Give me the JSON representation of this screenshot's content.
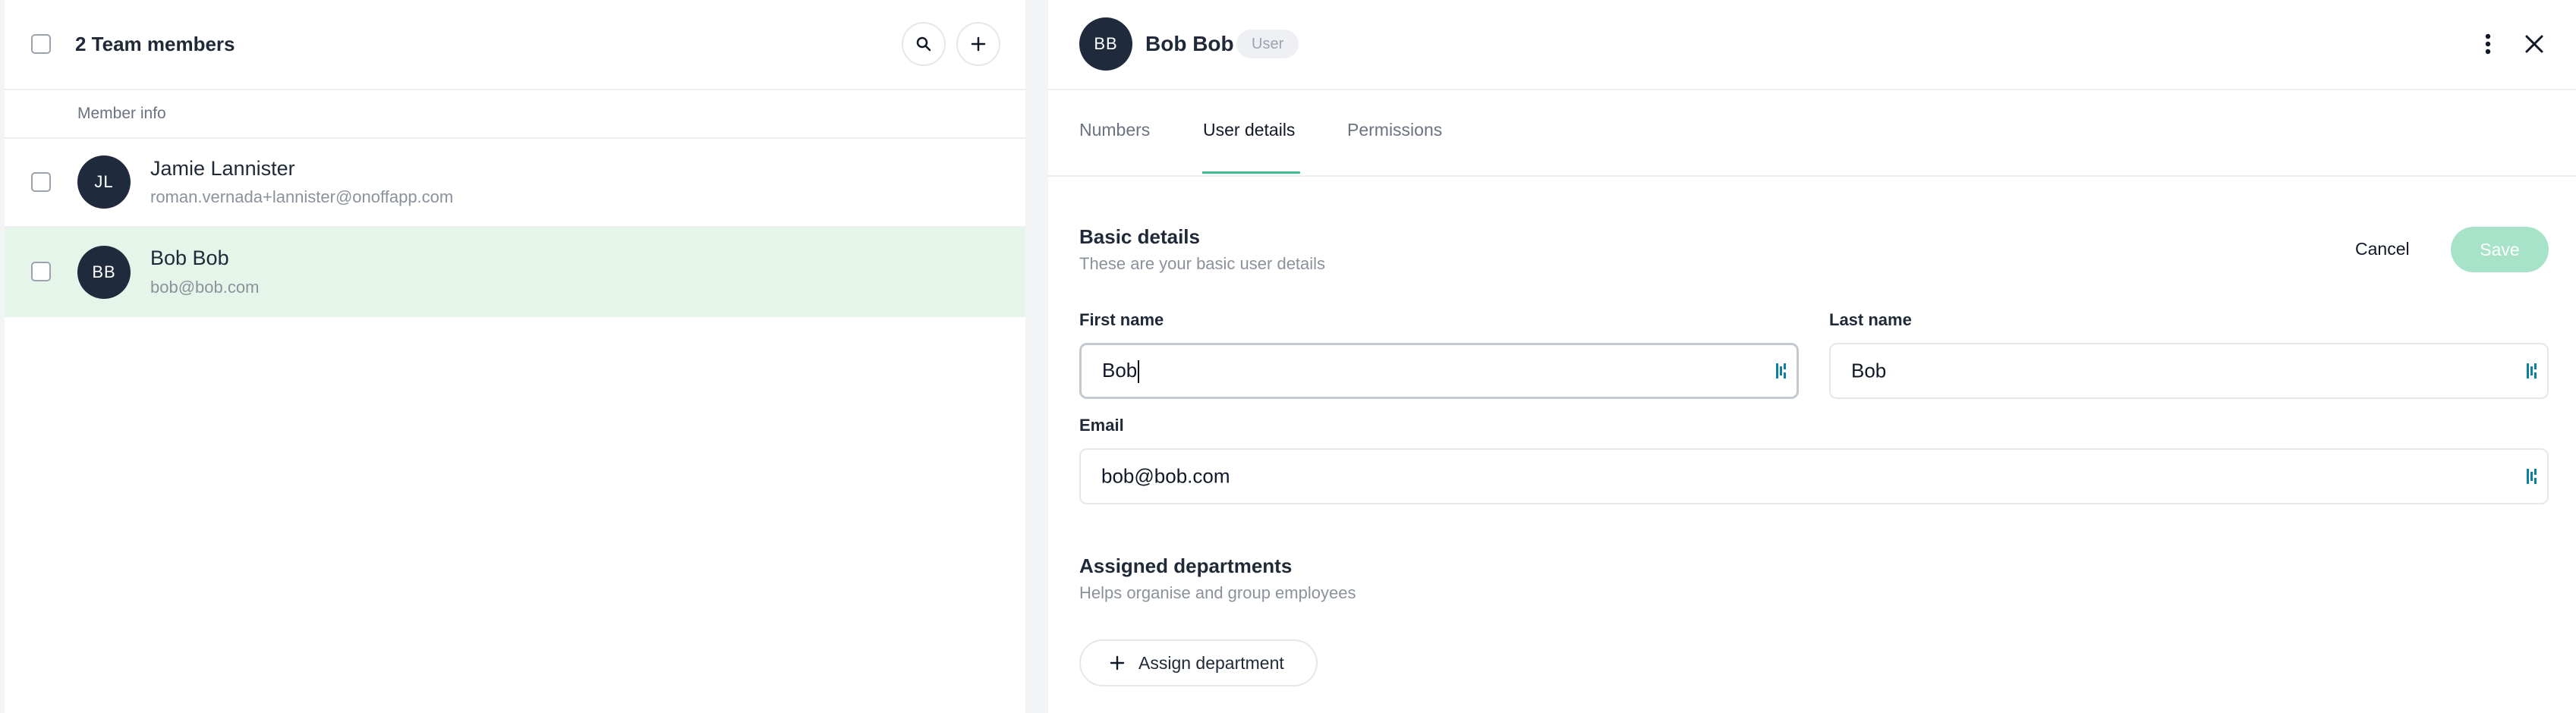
{
  "left_panel": {
    "header_title": "2 Team members",
    "column_header": "Member info",
    "members": [
      {
        "initials": "JL",
        "name": "Jamie Lannister",
        "email": "roman.vernada+lannister@onoffapp.com",
        "selected": false
      },
      {
        "initials": "BB",
        "name": "Bob Bob",
        "email": "bob@bob.com",
        "selected": true
      }
    ]
  },
  "right_panel": {
    "initials": "BB",
    "name": "Bob Bob",
    "role_badge": "User",
    "tabs": [
      "Numbers",
      "User details",
      "Permissions"
    ],
    "active_tab": "User details",
    "basic_details": {
      "title": "Basic details",
      "subtitle": "These are your basic user details",
      "cancel_label": "Cancel",
      "save_label": "Save"
    },
    "fields": {
      "first_name_label": "First name",
      "first_name_value": "Bob",
      "last_name_label": "Last name",
      "last_name_value": "Bob",
      "email_label": "Email",
      "email_value": "bob@bob.com"
    },
    "departments": {
      "title": "Assigned departments",
      "subtitle": "Helps organise and group employees",
      "assign_label": "Assign department"
    }
  },
  "colors": {
    "selected_row_bg": "#e5f5ea",
    "tab_underline": "#3fbf8f",
    "save_bg_disabled": "#a6e3c9",
    "avatar_bg": "#1f2a3d",
    "password_icon": "#0d7fa0"
  },
  "icons": {
    "search": "search-icon",
    "add": "plus-icon",
    "more": "more-vertical-icon",
    "close": "close-icon",
    "password_manager": "password-manager-icon",
    "assign": "plus-icon"
  }
}
